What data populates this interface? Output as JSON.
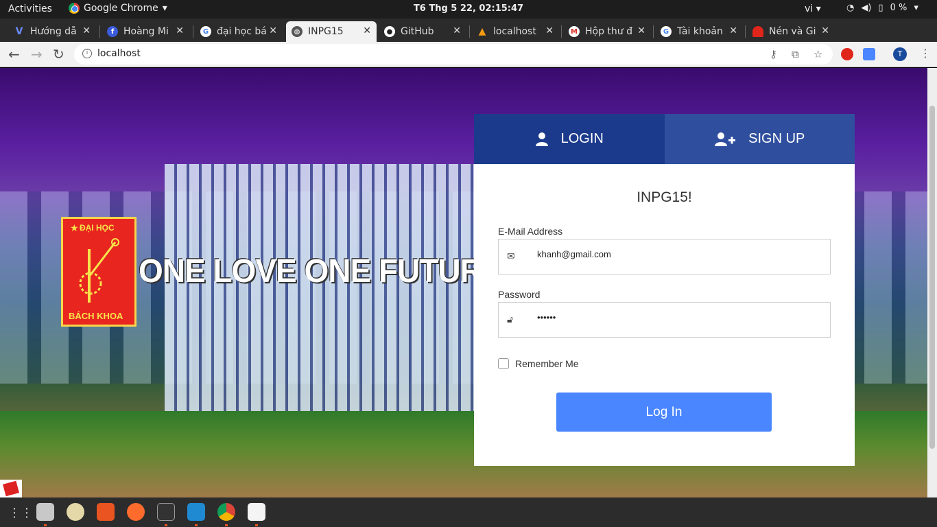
{
  "topbar": {
    "activities": "Activities",
    "app_name": "Google Chrome",
    "clock": "T6 Thg 5 22, 02:15:47",
    "language": "vi",
    "battery": "0 %"
  },
  "tabs": [
    {
      "title": "Hướng dẫ",
      "favicon": "V"
    },
    {
      "title": "Hoàng Mi",
      "favicon": "f"
    },
    {
      "title": "đại học bá",
      "favicon": "G"
    },
    {
      "title": "INPG15",
      "favicon": "globe"
    },
    {
      "title": "GitHub",
      "favicon": "github"
    },
    {
      "title": "localhost",
      "favicon": "a"
    },
    {
      "title": "Hộp thư đ",
      "favicon": "M"
    },
    {
      "title": "Tài khoản",
      "favicon": "G"
    },
    {
      "title": "Nén và Gi",
      "favicon": "red"
    }
  ],
  "address": {
    "url": "localhost"
  },
  "hero": {
    "logo_top": "ĐẠI HỌC",
    "logo_bottom": "BÁCH KHOA",
    "slogan": "ONE LOVE ONE FUTURE"
  },
  "card": {
    "tab_login": "LOGIN",
    "tab_signup": "SIGN UP",
    "title": "INPG15!",
    "email_label": "E-Mail Address",
    "email_value": "khanh@gmail.com",
    "password_label": "Password",
    "password_value": "••••••",
    "remember_label": "Remember Me",
    "login_button": "Log In"
  },
  "colors": {
    "tab_login_bg": "#1b3a8c",
    "tab_signup_bg": "#2f4f9e",
    "login_button_bg": "#4a86ff"
  }
}
